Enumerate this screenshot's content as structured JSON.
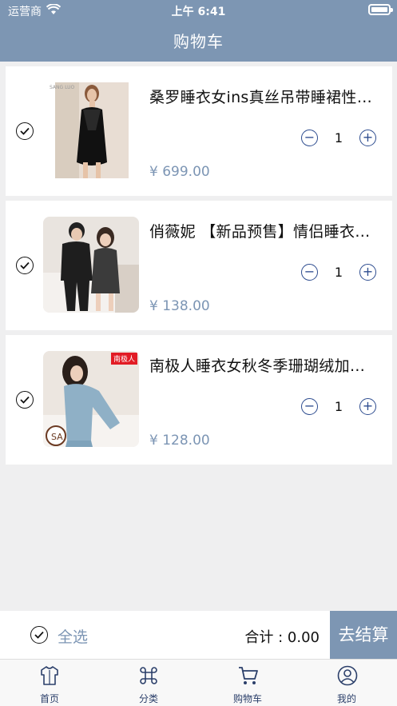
{
  "status_bar": {
    "carrier": "运营商",
    "time": "上午 6:41"
  },
  "nav": {
    "title": "购物车"
  },
  "items": [
    {
      "title": "桑罗睡衣女ins真丝吊带睡裙性感冰丝睡衣",
      "price": "¥ 699.00",
      "quantity": "1",
      "image_text": "SANG LUO"
    },
    {
      "title": "俏薇妮 【新品预售】情侣睡衣春秋季冰丝",
      "price": "¥ 138.00",
      "quantity": "1"
    },
    {
      "title": "南极人睡衣女秋冬季珊瑚绒加厚家居服套装",
      "price": "¥ 128.00",
      "quantity": "1",
      "image_text": "南极人"
    }
  ],
  "checkout_bar": {
    "select_all": "全选",
    "total": "合计 : 0.00",
    "checkout": "去结算"
  },
  "tabs": [
    {
      "label": "首页",
      "icon": "shirt-icon"
    },
    {
      "label": "分类",
      "icon": "command-icon"
    },
    {
      "label": "购物车",
      "icon": "cart-icon"
    },
    {
      "label": "我的",
      "icon": "user-icon"
    }
  ],
  "colors": {
    "brand": "#7d96b3",
    "price": "#7c95b4",
    "stepper": "#2d4c8f",
    "background": "#efeff0"
  }
}
